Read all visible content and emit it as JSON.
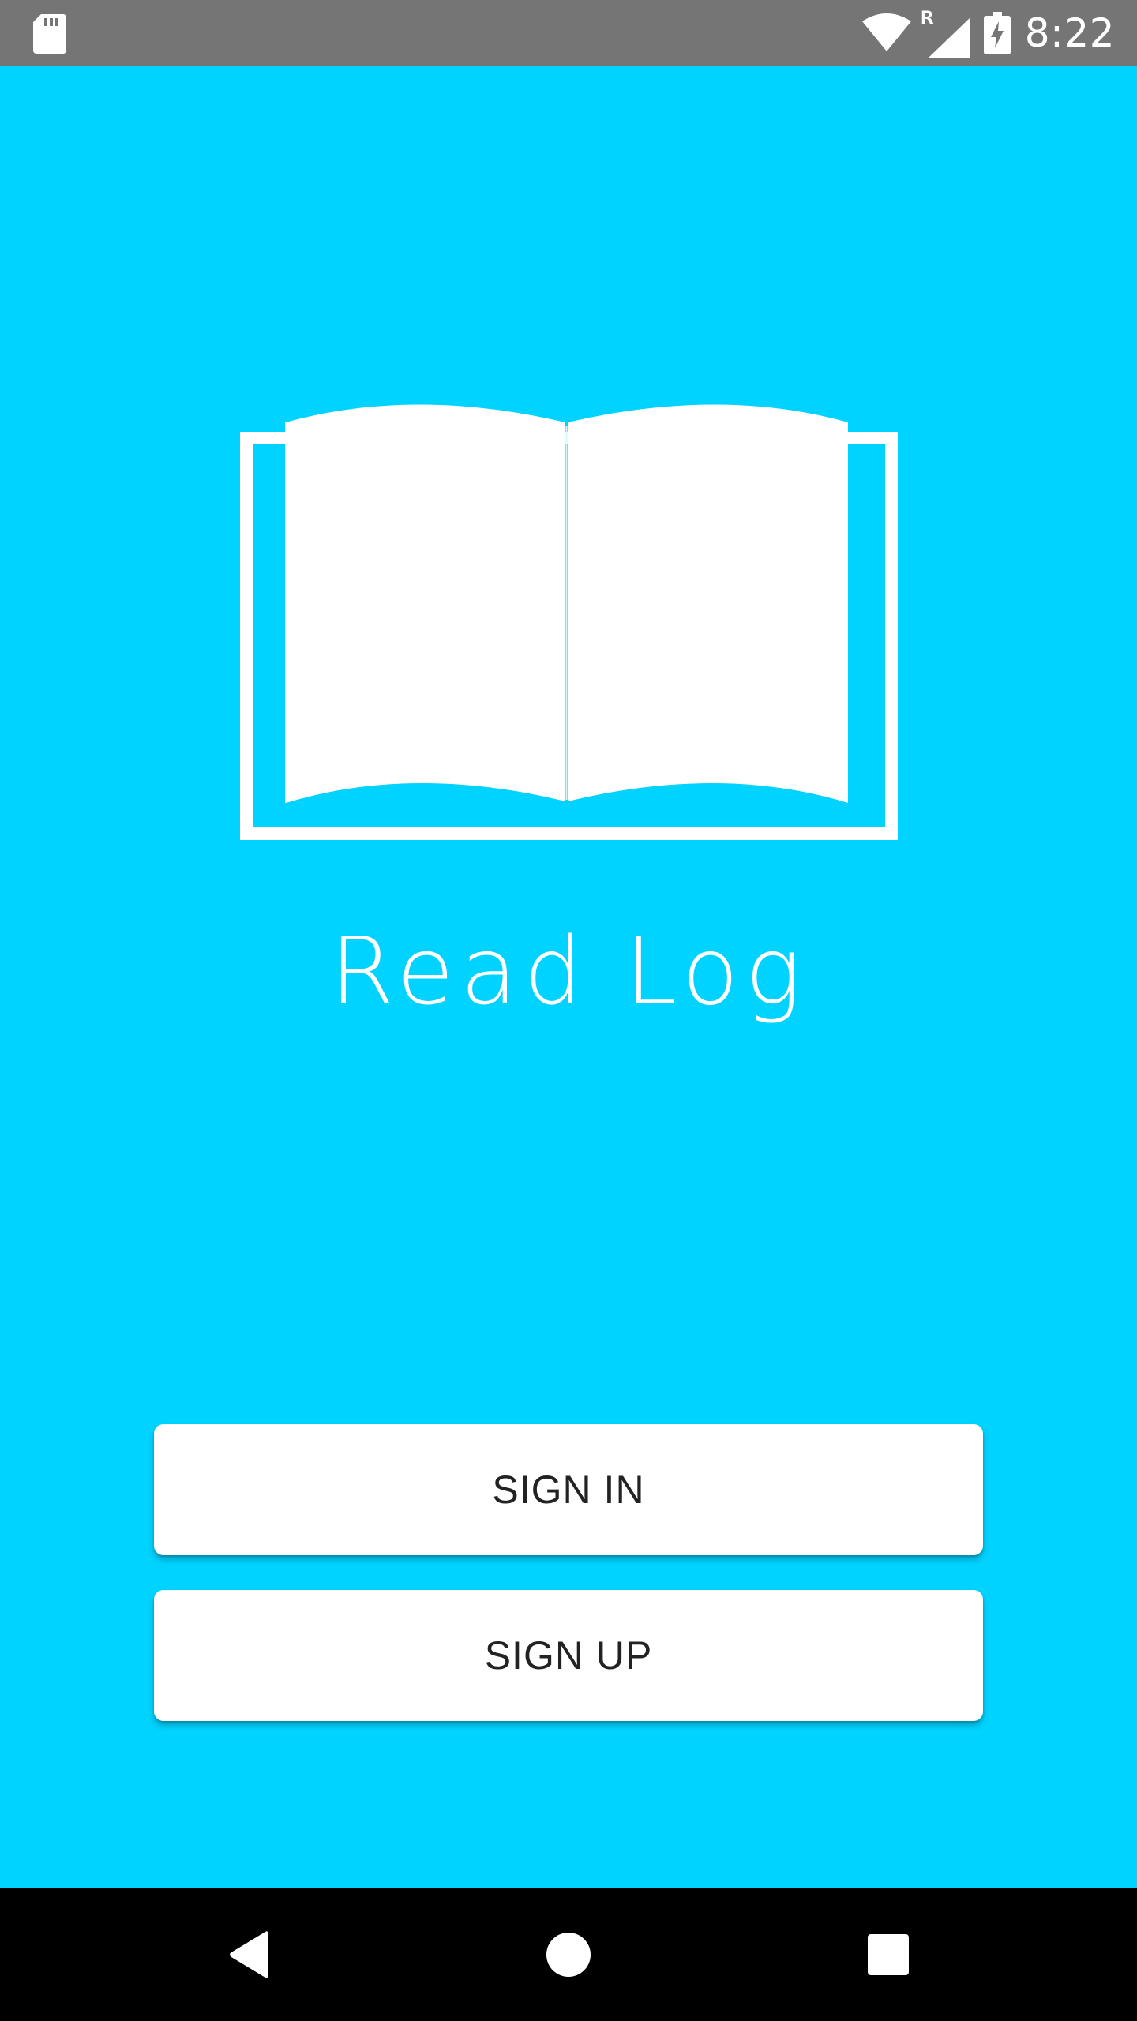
{
  "status_bar": {
    "time": "8:22",
    "icons": [
      "sd-card-icon",
      "wifi-icon",
      "roaming-icon",
      "signal-icon",
      "battery-charging-icon"
    ],
    "roaming_label": "R"
  },
  "app": {
    "logo_icon": "open-book-icon",
    "title": "Read Log"
  },
  "buttons": {
    "sign_in": "SIGN IN",
    "sign_up": "SIGN UP"
  },
  "nav_bar": {
    "icons": [
      "back-icon",
      "home-icon",
      "recents-icon"
    ]
  },
  "colors": {
    "background": "#00D3FF",
    "status_bar": "#757575",
    "nav_bar": "#000000",
    "button": "#ffffff",
    "button_text": "#222222"
  }
}
